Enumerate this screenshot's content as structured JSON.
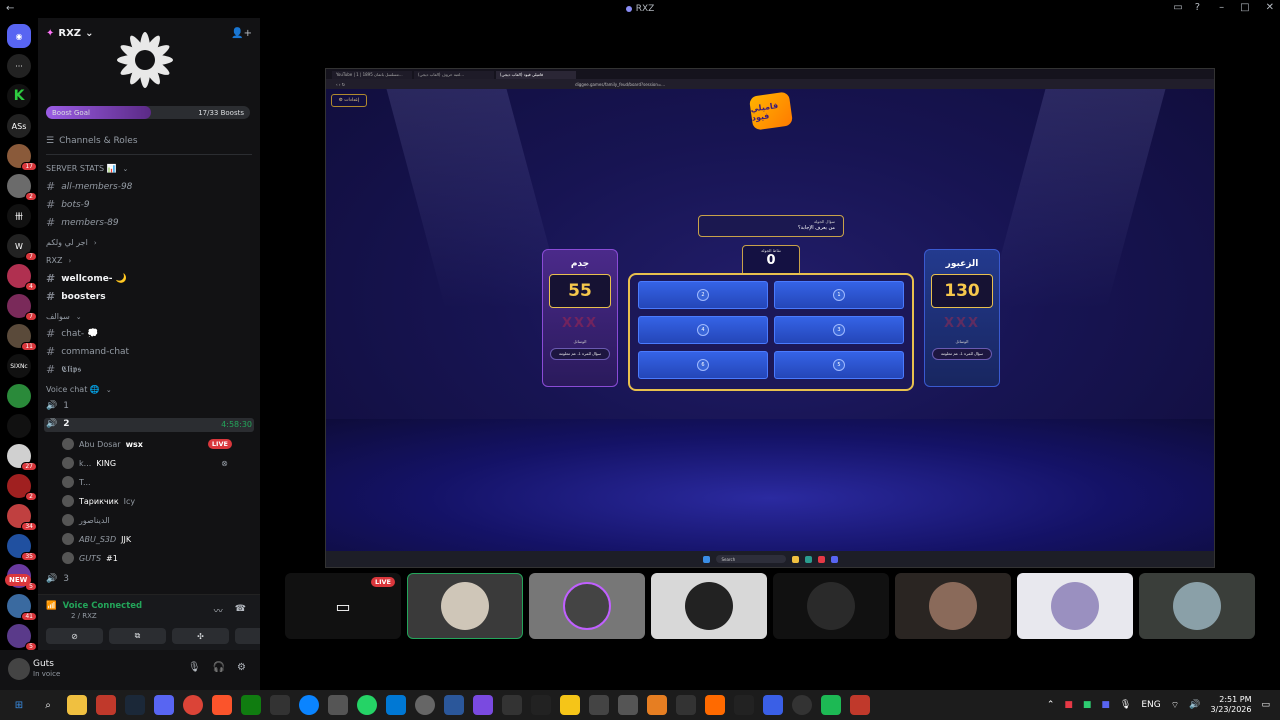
{
  "window": {
    "title": "RXZ"
  },
  "rail": {
    "badges": [
      "17",
      "2",
      "7",
      "4",
      "7",
      "11",
      "27",
      "2",
      "34",
      "35",
      "5",
      "41",
      "5"
    ],
    "labels": [
      "ASs",
      "SIXNc"
    ],
    "new_label": "NEW"
  },
  "server": {
    "name": "RXZ",
    "boost_label": "Boost Goal",
    "boost_count": "17/33 Boosts",
    "boost_progress": 0.515,
    "channels_roles": "Channels & Roles"
  },
  "channels": [
    {
      "label": "SERVER STATS 📊",
      "kind": "category"
    },
    {
      "label": "all-members-98",
      "kind": "text-italic"
    },
    {
      "label": "bots-9",
      "kind": "text-italic"
    },
    {
      "label": "members-89",
      "kind": "text-italic"
    },
    {
      "label": "اجر لي ولكم",
      "kind": "category"
    },
    {
      "label": "RXZ",
      "kind": "category"
    },
    {
      "label": "wellcome- 🌙",
      "kind": "text-bold"
    },
    {
      "label": "boosters",
      "kind": "text-bold"
    },
    {
      "label": "سوالف",
      "kind": "category"
    },
    {
      "label": "chat- 💭",
      "kind": "text"
    },
    {
      "label": "command-chat",
      "kind": "text"
    },
    {
      "label": "𝕮𝖑𝖎𝖕𝖘",
      "kind": "text"
    },
    {
      "label": "Voice chat 🌐",
      "kind": "category"
    },
    {
      "label": "1",
      "kind": "voice"
    },
    {
      "label": "2",
      "kind": "voice-active"
    }
  ],
  "voice_channel": {
    "time": "4:58:30",
    "users": [
      {
        "name": "Abu Dosar",
        "tag": "wsx",
        "live": "LIVE"
      },
      {
        "name": "k...",
        "tag": "KING"
      },
      {
        "name": "T..."
      },
      {
        "name": "Тарикчик",
        "tag": "Icy"
      },
      {
        "name": "الديناصور"
      },
      {
        "name": "ABU_S3D",
        "tag": "JJK"
      },
      {
        "name": "GUTS",
        "tag": "#1"
      }
    ],
    "next_channel": "3"
  },
  "voice_panel": {
    "status": "Voice Connected",
    "location": "2 / RXZ"
  },
  "user": {
    "name": "Guts",
    "status": "In voice"
  },
  "browser": {
    "tabs": [
      "YouTube | 1 | مسلسل باتمان 1895...",
      "لعبة حروف (العاب ديجي)...",
      "فاميلي فيود (العاب ديجي)"
    ],
    "url": "diggee.games/family_feud/board?session=..."
  },
  "game": {
    "settings_label": "⚙ إعدادات",
    "logo_text": "فاميلي فيود",
    "question_label": "سؤال الجولة",
    "question_text": "من يعرف الإجابة؟",
    "round_points_label": "نقاط الجولة",
    "round_points": "0",
    "answers": [
      "2",
      "1",
      "4",
      "3",
      "6",
      "5"
    ],
    "team_left": {
      "name": "جدم",
      "score": "55",
      "strikes": "XXX",
      "tools_label": "الوسائل",
      "tool": "سؤال للمرة 1، عم معلومة"
    },
    "team_right": {
      "name": "الزعبور",
      "score": "130",
      "strikes": "XXX",
      "tools_label": "الوسائل",
      "tool": "سؤال للمرة 1، عم معلومة"
    },
    "taskbar_search": "Search"
  },
  "tiles": [
    {
      "name": "screen-share",
      "live": "LIVE"
    },
    {
      "name": "participant-1"
    },
    {
      "name": "participant-2"
    },
    {
      "name": "participant-3"
    },
    {
      "name": "participant-4"
    },
    {
      "name": "participant-5"
    },
    {
      "name": "participant-6"
    },
    {
      "name": "participant-7"
    }
  ],
  "taskbar": {
    "lang": "ENG",
    "time": "2:51 PM",
    "date": "3/23/2026"
  }
}
